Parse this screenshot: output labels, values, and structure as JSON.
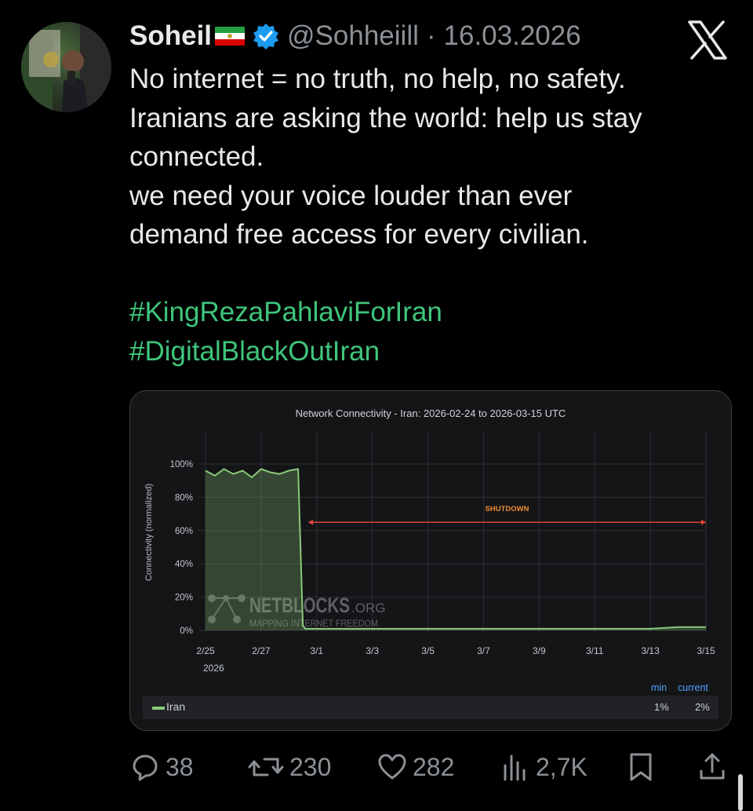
{
  "tweet": {
    "author_name": "Soheil",
    "handle": "@Sohheiill",
    "separator": "·",
    "date": "16.03.2026",
    "lines": [
      "No internet = no truth, no help, no safety.",
      "Iranians are asking the world: help us stay connected.",
      "we need your voice louder than ever",
      "demand free access for every civilian."
    ],
    "hashtags": [
      "#KingRezaPahlaviForIran",
      "#DigitalBlackOutIran"
    ]
  },
  "icons": {
    "flag": "iran-lion-and-sun-flag-icon",
    "verified": "verified-badge-icon",
    "brand": "x-logo-icon"
  },
  "colors": {
    "background": "#000000",
    "hashtag": "#3fc57c",
    "verified": "#1d9bf0",
    "series": "#8bc97a",
    "shutdown": "#e0443c",
    "legend_header": "#4da3ff"
  },
  "chart_data": {
    "type": "area",
    "title": "Network Connectivity - Iran: 2026-02-24 to 2026-03-15 UTC",
    "ylabel": "Connectivity (normalized)",
    "xlabel": "",
    "ylim": [
      0,
      100
    ],
    "y_ticks": [
      "100%",
      "80%",
      "60%",
      "40%",
      "20%",
      "0%"
    ],
    "x_ticks": [
      "2/25",
      "2/27",
      "3/1",
      "3/3",
      "3/5",
      "3/7",
      "3/9",
      "3/11",
      "3/13",
      "3/15"
    ],
    "x_tick_year": "2026",
    "series": [
      {
        "name": "Iran",
        "x": [
          "2026-02-25",
          "2026-02-25T08",
          "2026-02-25T16",
          "2026-02-26",
          "2026-02-26T08",
          "2026-02-26T16",
          "2026-02-27",
          "2026-02-27T08",
          "2026-02-27T16",
          "2026-02-28",
          "2026-02-28T08",
          "2026-02-28T12",
          "2026-02-28T14",
          "2026-02-28T20",
          "2026-03-01",
          "2026-03-03",
          "2026-03-05",
          "2026-03-07",
          "2026-03-09",
          "2026-03-11",
          "2026-03-13",
          "2026-03-14",
          "2026-03-15"
        ],
        "y": [
          96,
          93,
          97,
          94,
          96,
          92,
          97,
          95,
          94,
          96,
          97,
          3,
          1,
          1,
          1,
          1,
          1,
          1,
          1,
          1,
          1,
          2,
          2
        ]
      }
    ],
    "annotation": {
      "label": "SHUTDOWN",
      "from": "2026-02-28T14",
      "to": "2026-03-15",
      "y": 65
    },
    "watermark": {
      "brand": "NETBLOCKS",
      "suffix": ".ORG",
      "tagline": "MAPPING INTERNET FREEDOM"
    },
    "legend": {
      "headers": [
        "min",
        "current"
      ],
      "rows": [
        {
          "name": "Iran",
          "min": "1%",
          "current": "2%"
        }
      ]
    },
    "grid": true
  },
  "actions": {
    "replies": "38",
    "reposts": "230",
    "likes": "282",
    "views": "2,7K"
  }
}
